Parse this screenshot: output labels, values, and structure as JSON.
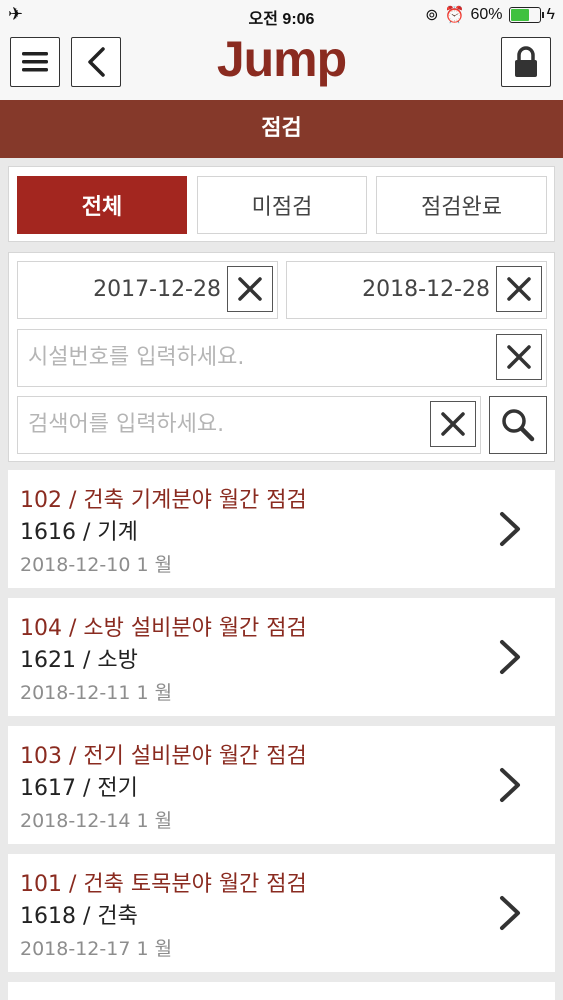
{
  "status_bar": {
    "time": "오전 9:06",
    "battery": "60%"
  },
  "header": {
    "logo": "Jump"
  },
  "page_title": "점검",
  "tabs": [
    {
      "label": "전체",
      "active": true
    },
    {
      "label": "미점검",
      "active": false
    },
    {
      "label": "점검완료",
      "active": false
    }
  ],
  "filters": {
    "start_date": "2017-12-28",
    "end_date": "2018-12-28",
    "facility_placeholder": "시설번호를 입력하세요.",
    "keyword_placeholder": "검색어를 입력하세요."
  },
  "items": [
    {
      "title": "102 / 건축 기계분야 월간 점검",
      "sub": "1616 / 기계",
      "date": "2018-12-10 1 월"
    },
    {
      "title": "104 / 소방 설비분야 월간 점검",
      "sub": "1621 / 소방",
      "date": "2018-12-11 1 월"
    },
    {
      "title": "103 / 전기 설비분야 월간 점검",
      "sub": "1617 / 전기",
      "date": "2018-12-14 1 월"
    },
    {
      "title": "101 / 건축 토목분야 월간 점검",
      "sub": "1618 / 건축",
      "date": "2018-12-17 1 월"
    }
  ],
  "colors": {
    "brand": "#85392a",
    "active_tab": "#a3261f",
    "item_title": "#8a2b20"
  }
}
